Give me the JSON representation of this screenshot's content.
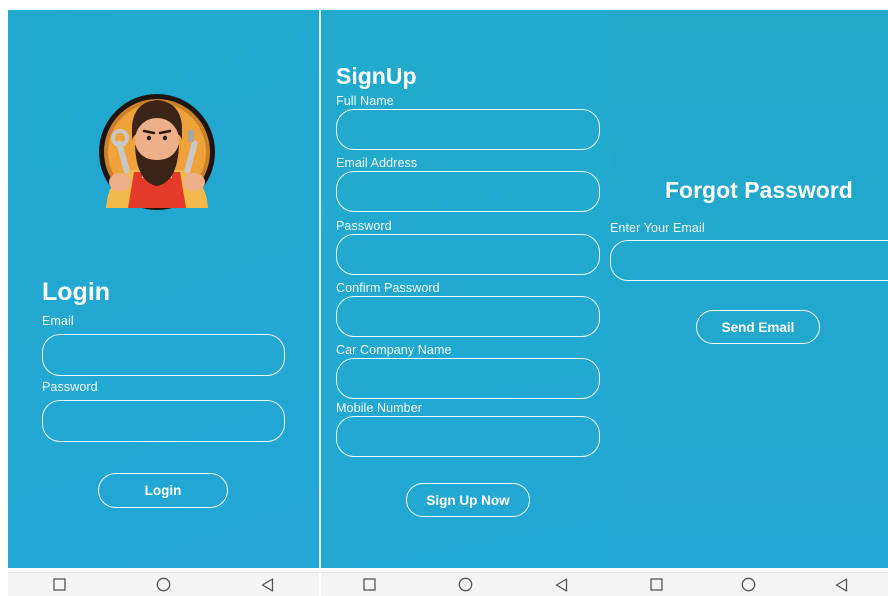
{
  "login": {
    "title": "Login",
    "email_label": "Email",
    "email_value": "",
    "password_label": "Password",
    "password_value": "",
    "login_button": "Login"
  },
  "signup": {
    "title": "SignUp",
    "fields": [
      {
        "label": "Full Name",
        "value": ""
      },
      {
        "label": "Email Address",
        "value": ""
      },
      {
        "label": "Password",
        "value": ""
      },
      {
        "label": "Confirm Password",
        "value": ""
      },
      {
        "label": "Car Company Name",
        "value": ""
      },
      {
        "label": "Mobile Number",
        "value": ""
      }
    ],
    "submit_button": "Sign Up Now"
  },
  "forgot": {
    "title": "Forgot Password",
    "email_label": "Enter Your Email",
    "email_value": "",
    "send_button": "Send Email"
  },
  "navbar": {
    "icons": [
      "recent-apps-icon",
      "home-icon",
      "back-icon"
    ]
  },
  "colors": {
    "background": "#22a8d0",
    "accent": "#ffffff",
    "navbar": "#f5f5f5"
  }
}
